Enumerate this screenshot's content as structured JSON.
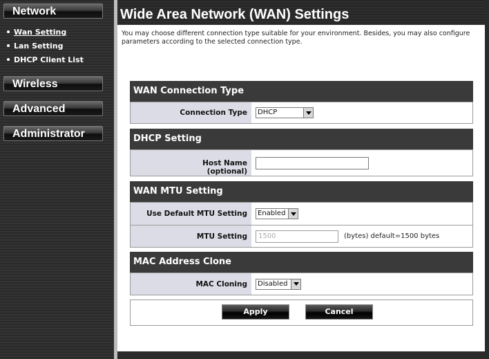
{
  "sidebar": {
    "network": "Network",
    "items": [
      {
        "label": "Wan Setting"
      },
      {
        "label": "Lan Setting"
      },
      {
        "label": "DHCP Client List"
      }
    ],
    "wireless": "Wireless",
    "advanced": "Advanced",
    "administrator": "Administrator"
  },
  "page": {
    "title": "Wide Area Network (WAN) Settings",
    "intro": "You may choose different connection type suitable for your environment. Besides, you may also configure parameters according to the selected connection type."
  },
  "wan_type": {
    "heading": "WAN Connection Type",
    "label": "Connection Type",
    "value": "DHCP"
  },
  "dhcp": {
    "heading": "DHCP Setting",
    "host_label": "Host Name",
    "host_sub": "(optional)",
    "host_value": ""
  },
  "mtu": {
    "heading": "WAN MTU Setting",
    "default_label": "Use Default MTU Setting",
    "default_value": "Enabled",
    "mtu_label": "MTU Setting",
    "mtu_value": "1500",
    "mtu_hint": "(bytes) default=1500 bytes"
  },
  "mac": {
    "heading": "MAC Address Clone",
    "label": "MAC Cloning",
    "value": "Disabled"
  },
  "buttons": {
    "apply": "Apply",
    "cancel": "Cancel"
  }
}
